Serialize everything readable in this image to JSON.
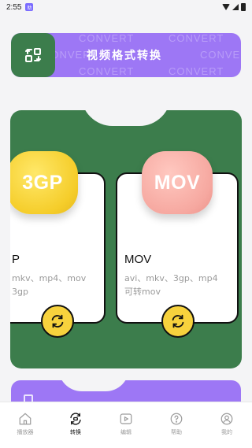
{
  "status_bar": {
    "time": "2:55",
    "app_badge": "助"
  },
  "banner": {
    "title": "视频格式转换",
    "watermark": "CONVERT",
    "icon": "convert-arrows-icon",
    "bg_color": "#9d77f5",
    "icon_bg_color": "#3c7d4c"
  },
  "formats": [
    {
      "blob_label": "3GP",
      "name": "P",
      "desc": "mkv、mp4、mov\n3gp",
      "blob_color": "#f7d23d"
    },
    {
      "blob_label": "MOV",
      "name": "MOV",
      "desc": "avi、mkv、3gp、mp4\n可转mov",
      "blob_color": "#f6a8a0"
    }
  ],
  "panel_color": "#3c7d4c",
  "nav": [
    {
      "label": "播放器",
      "icon": "home-icon"
    },
    {
      "label": "转换",
      "icon": "convert-icon"
    },
    {
      "label": "编辑",
      "icon": "play-icon"
    },
    {
      "label": "帮助",
      "icon": "help-icon"
    },
    {
      "label": "我的",
      "icon": "profile-icon"
    }
  ],
  "active_nav": "转换"
}
